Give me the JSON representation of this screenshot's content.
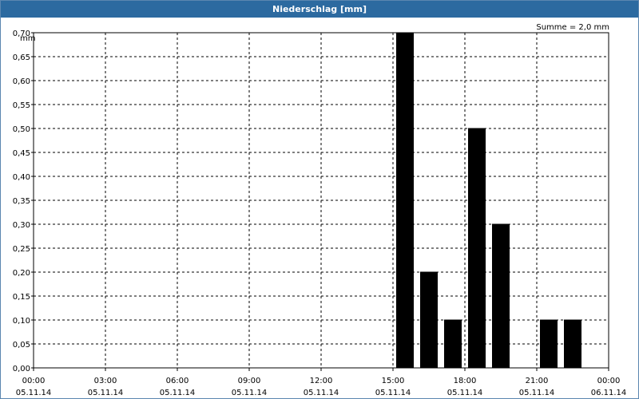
{
  "window": {
    "title": "Niederschlag [mm]",
    "titlebar_color": "#2c6aa0"
  },
  "chart_data": {
    "type": "bar",
    "title": "Niederschlag [mm]",
    "ylabel": "mm",
    "ylim": [
      0,
      0.7
    ],
    "yticks": [
      "0,00",
      "0,05",
      "0,10",
      "0,15",
      "0,20",
      "0,25",
      "0,30",
      "0,35",
      "0,40",
      "0,45",
      "0,50",
      "0,55",
      "0,60",
      "0,65",
      "0,70"
    ],
    "xticks": [
      {
        "time": "00:00",
        "date": "05.11.14"
      },
      {
        "time": "03:00",
        "date": "05.11.14"
      },
      {
        "time": "06:00",
        "date": "05.11.14"
      },
      {
        "time": "09:00",
        "date": "05.11.14"
      },
      {
        "time": "12:00",
        "date": "05.11.14"
      },
      {
        "time": "15:00",
        "date": "05.11.14"
      },
      {
        "time": "18:00",
        "date": "05.11.14"
      },
      {
        "time": "21:00",
        "date": "05.11.14"
      },
      {
        "time": "00:00",
        "date": "06.11.14"
      }
    ],
    "xlim_hours": [
      0,
      24
    ],
    "bars": [
      {
        "hour_start": 15,
        "value": 0.7
      },
      {
        "hour_start": 16,
        "value": 0.2
      },
      {
        "hour_start": 17,
        "value": 0.1
      },
      {
        "hour_start": 18,
        "value": 0.5
      },
      {
        "hour_start": 19,
        "value": 0.3
      },
      {
        "hour_start": 21,
        "value": 0.1
      },
      {
        "hour_start": 22,
        "value": 0.1
      }
    ],
    "annotation": "Summe = 2,0 mm",
    "grid": "dashed",
    "bar_color": "#000000"
  }
}
